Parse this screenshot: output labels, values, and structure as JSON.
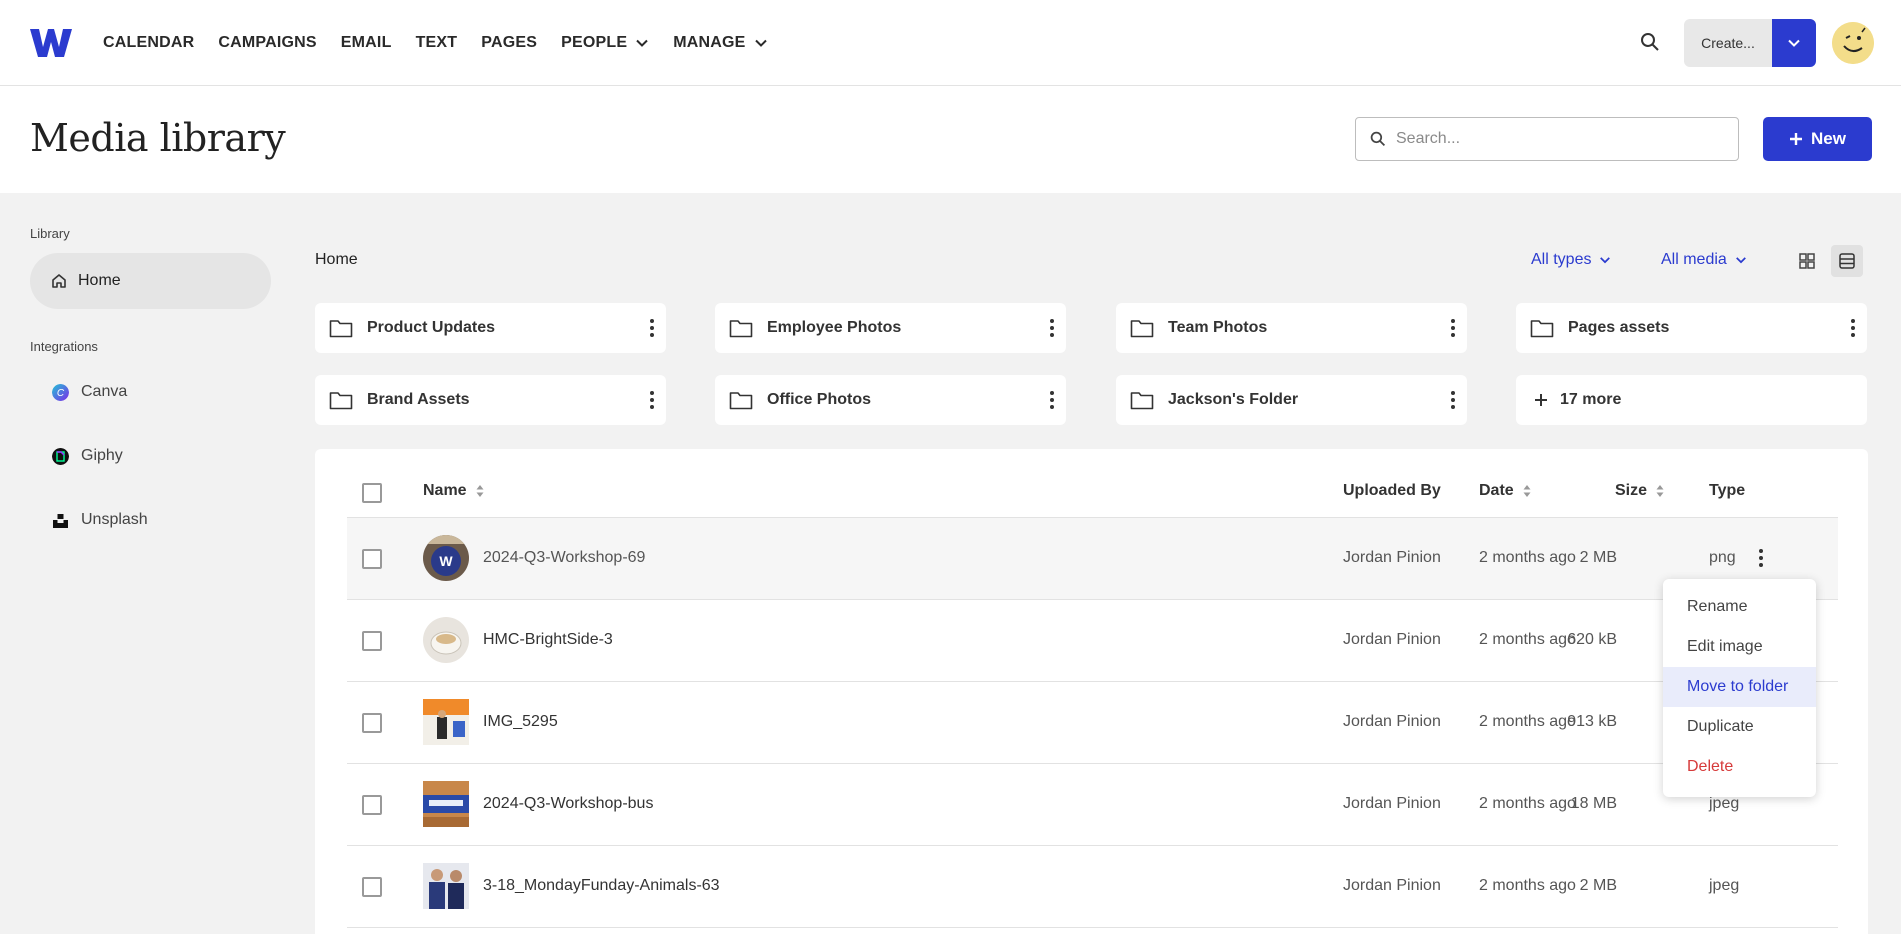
{
  "nav": {
    "items": [
      "CALENDAR",
      "CAMPAIGNS",
      "EMAIL",
      "TEXT",
      "PAGES"
    ],
    "people": "PEOPLE",
    "manage": "MANAGE",
    "create_label": "Create..."
  },
  "header": {
    "title": "Media library",
    "search_placeholder": "Search...",
    "new_label": "New"
  },
  "sidebar": {
    "library_label": "Library",
    "home": "Home",
    "integrations_label": "Integrations",
    "integrations": [
      "Canva",
      "Giphy",
      "Unsplash"
    ]
  },
  "content": {
    "breadcrumb": "Home",
    "filter_types": "All types",
    "filter_media": "All media",
    "folders": [
      "Product Updates",
      "Employee Photos",
      "Team Photos",
      "Pages assets",
      "Brand Assets",
      "Office Photos",
      "Jackson's Folder"
    ],
    "more": "17 more"
  },
  "table": {
    "headers": {
      "name": "Name",
      "uploaded_by": "Uploaded By",
      "date": "Date",
      "size": "Size",
      "type": "Type"
    },
    "rows": [
      {
        "name": "2024-Q3-Workshop-69",
        "uploaded_by": "Jordan Pinion",
        "date": "2 months ago",
        "size": "2 MB",
        "type": "png"
      },
      {
        "name": "HMC-BrightSide-3",
        "uploaded_by": "Jordan Pinion",
        "date": "2 months ago",
        "size": "620 kB",
        "type": ""
      },
      {
        "name": "IMG_5295",
        "uploaded_by": "Jordan Pinion",
        "date": "2 months ago",
        "size": "913 kB",
        "type": ""
      },
      {
        "name": "2024-Q3-Workshop-bus",
        "uploaded_by": "Jordan Pinion",
        "date": "2 months ago",
        "size": "18 MB",
        "type": "jpeg"
      },
      {
        "name": "3-18_MondayFunday-Animals-63",
        "uploaded_by": "Jordan Pinion",
        "date": "2 months ago",
        "size": "2 MB",
        "type": "jpeg"
      }
    ]
  },
  "context_menu": {
    "items": [
      "Rename",
      "Edit image",
      "Move to folder",
      "Duplicate",
      "Delete"
    ]
  },
  "colors": {
    "accent": "#2b3bcf",
    "danger": "#d63a3a"
  }
}
